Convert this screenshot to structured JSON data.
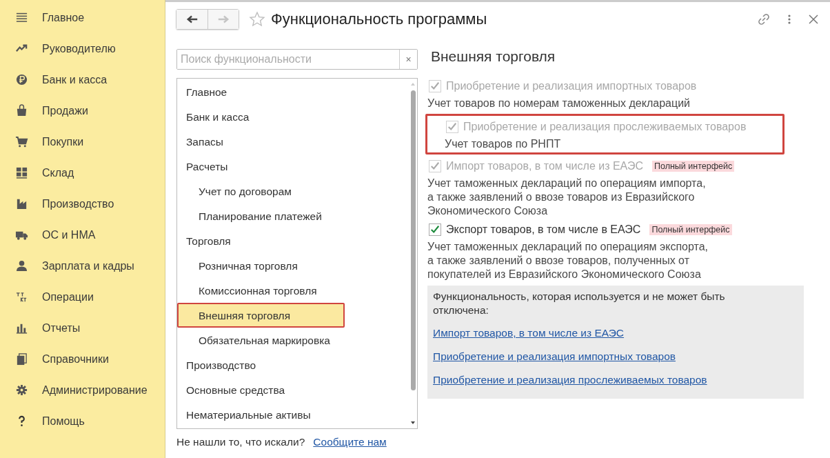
{
  "sidebar": {
    "items": [
      {
        "label": "Главное"
      },
      {
        "label": "Руководителю"
      },
      {
        "label": "Банк и касса"
      },
      {
        "label": "Продажи"
      },
      {
        "label": "Покупки"
      },
      {
        "label": "Склад"
      },
      {
        "label": "Производство"
      },
      {
        "label": "ОС и НМА"
      },
      {
        "label": "Зарплата и кадры"
      },
      {
        "label": "Операции"
      },
      {
        "label": "Отчеты"
      },
      {
        "label": "Справочники"
      },
      {
        "label": "Администрирование"
      },
      {
        "label": "Помощь"
      }
    ]
  },
  "window": {
    "title": "Функциональность программы",
    "back_disabled": false,
    "forward_disabled": true,
    "favorite": false
  },
  "search": {
    "placeholder": "Поиск функциональности",
    "clear": "×"
  },
  "sections": [
    {
      "label": "Главное",
      "selected": false,
      "highlighted": false
    },
    {
      "label": "Банк и касса",
      "selected": false,
      "highlighted": false
    },
    {
      "label": "Запасы",
      "selected": false,
      "highlighted": false
    },
    {
      "label": "Расчеты",
      "selected": false,
      "highlighted": false,
      "children": [
        {
          "label": "Учет по договорам",
          "selected": false,
          "highlighted": false
        },
        {
          "label": "Планирование платежей",
          "selected": false,
          "highlighted": false
        }
      ]
    },
    {
      "label": "Торговля",
      "selected": false,
      "highlighted": false,
      "children": [
        {
          "label": "Розничная торговля",
          "selected": false,
          "highlighted": false
        },
        {
          "label": "Комиссионная торговля",
          "selected": false,
          "highlighted": false
        },
        {
          "label": "Внешняя торговля",
          "selected": true,
          "highlighted": true
        },
        {
          "label": "Обязательная маркировка",
          "selected": false,
          "highlighted": false
        }
      ]
    },
    {
      "label": "Производство",
      "selected": false,
      "highlighted": false
    },
    {
      "label": "Основные средства",
      "selected": false,
      "highlighted": false
    },
    {
      "label": "Нематериальные активы",
      "selected": false,
      "highlighted": false
    }
  ],
  "content": {
    "heading": "Внешняя торговля",
    "options": [
      {
        "label": "Приобретение и реализация импортных товаров",
        "checked": true,
        "disabled": true,
        "highlighted": false,
        "description": "Учет товаров по номерам таможенных деклараций",
        "children": [
          {
            "label": "Приобретение и реализация прослеживаемых товаров",
            "checked": true,
            "disabled": true,
            "highlighted": true,
            "description": "Учет товаров по РНПТ"
          }
        ]
      },
      {
        "label": "Импорт товаров, в том числе из ЕАЭС",
        "checked": true,
        "disabled": true,
        "highlighted": false,
        "badge": "Полный интерфейс",
        "description": "Учет таможенных деклараций по операциям импорта,\nа также заявлений о ввозе товаров из Евразийского\nЭкономического Союза"
      },
      {
        "label": "Экспорт товаров, в том числе в ЕАЭС",
        "checked": true,
        "disabled": false,
        "highlighted": false,
        "badge": "Полный интерфейс",
        "description": "Учет таможенных деклараций по операциям экспорта,\nа также заявлений о ввозе товаров, полученных от\nпокупателей из Евразийского Экономического Союза"
      }
    ],
    "info": {
      "text": "Функциональность, которая используется и не может быть отключена:",
      "links": [
        "Импорт товаров, в том числе из ЕАЭС",
        "Приобретение и реализация импортных товаров",
        "Приобретение и реализация прослеживаемых товаров"
      ]
    }
  },
  "footer": {
    "text": "Не нашли то, что искали?",
    "link": "Сообщите нам"
  }
}
